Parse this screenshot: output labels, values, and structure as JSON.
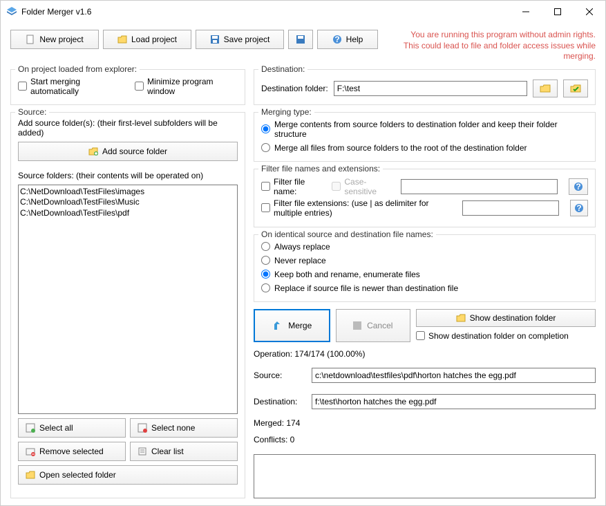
{
  "window": {
    "title": "Folder Merger v1.6"
  },
  "toolbar": {
    "new_project": "New project",
    "load_project": "Load project",
    "save_project": "Save project",
    "help": "Help"
  },
  "warning": {
    "line1": "You are running this program without admin rights.",
    "line2": "This could lead to file and folder access issues while merging."
  },
  "explorer": {
    "legend": "On project loaded from explorer:",
    "start_merging": "Start merging automatically",
    "minimize": "Minimize program window"
  },
  "source": {
    "legend": "Source:",
    "add_hint": "Add source folder(s): (their first-level subfolders will be added)",
    "add_btn": "Add source folder",
    "list_label": "Source folders: (their contents will be operated on)",
    "folders": "C:\\NetDownload\\TestFiles\\images\nC:\\NetDownload\\TestFiles\\Music\nC:\\NetDownload\\TestFiles\\pdf",
    "select_all": "Select all",
    "select_none": "Select none",
    "remove_selected": "Remove selected",
    "clear_list": "Clear list",
    "open_selected": "Open selected folder"
  },
  "destination": {
    "legend": "Destination:",
    "label": "Destination folder:",
    "value": "F:\\test"
  },
  "merging_type": {
    "legend": "Merging type:",
    "opt1": "Merge contents from source folders to destination folder and keep their folder structure",
    "opt2": "Merge all files from source folders to the root of the destination folder"
  },
  "filter": {
    "legend": "Filter file names and extensions:",
    "filter_name": "Filter file name:",
    "case_sensitive": "Case-sensitive",
    "filter_ext": "Filter file extensions: (use | as delimiter for multiple entries)"
  },
  "identical": {
    "legend": "On identical source and destination file names:",
    "opt1": "Always replace",
    "opt2": "Never replace",
    "opt3": "Keep both and rename, enumerate files",
    "opt4": "Replace if source file is newer than destination file"
  },
  "actions": {
    "merge": "Merge",
    "cancel": "Cancel",
    "show_dest": "Show destination folder",
    "show_on_complete": "Show destination folder on completion"
  },
  "status": {
    "operation": "Operation: 174/174 (100.00%)",
    "source_label": "Source:",
    "source_value": "c:\\netdownload\\testfiles\\pdf\\horton hatches the egg.pdf",
    "dest_label": "Destination:",
    "dest_value": "f:\\test\\horton hatches the egg.pdf",
    "merged": "Merged: 174",
    "conflicts": "Conflicts: 0"
  }
}
